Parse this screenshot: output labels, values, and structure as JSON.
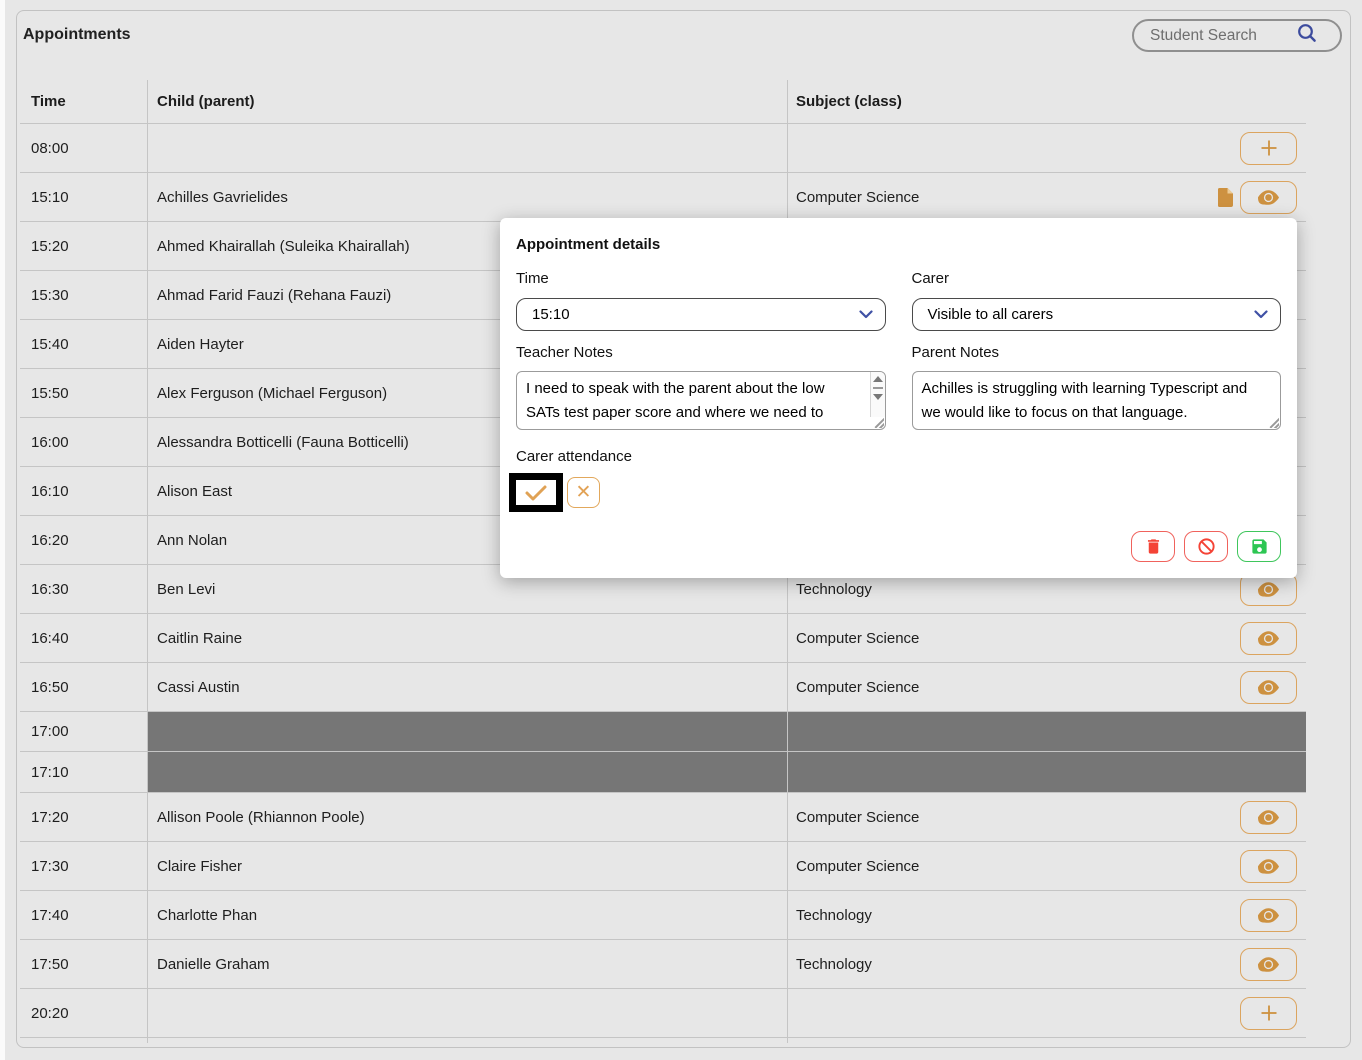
{
  "title": "Appointments",
  "search": {
    "placeholder": "Student Search"
  },
  "table": {
    "columns": {
      "time": "Time",
      "child": "Child (parent)",
      "subject": "Subject (class)"
    },
    "rows": [
      {
        "time": "08:00",
        "child": "",
        "subject": "",
        "type": "empty",
        "action": "add",
        "copy": false
      },
      {
        "time": "15:10",
        "child": "Achilles Gavrielides",
        "subject": "Computer Science",
        "type": "booked",
        "action": "view",
        "copy": true
      },
      {
        "time": "15:20",
        "child": "Ahmed Khairallah (Suleika Khairallah)",
        "subject": "",
        "type": "booked",
        "action": null,
        "copy": false
      },
      {
        "time": "15:30",
        "child": "Ahmad Farid Fauzi (Rehana Fauzi)",
        "subject": "",
        "type": "booked",
        "action": null,
        "copy": false
      },
      {
        "time": "15:40",
        "child": "Aiden Hayter",
        "subject": "",
        "type": "booked",
        "action": null,
        "copy": false
      },
      {
        "time": "15:50",
        "child": "Alex Ferguson (Michael Ferguson)",
        "subject": "",
        "type": "booked",
        "action": null,
        "copy": false
      },
      {
        "time": "16:00",
        "child": "Alessandra Botticelli (Fauna Botticelli)",
        "subject": "",
        "type": "booked",
        "action": null,
        "copy": false
      },
      {
        "time": "16:10",
        "child": "Alison East",
        "subject": "",
        "type": "booked",
        "action": null,
        "copy": false
      },
      {
        "time": "16:20",
        "child": "Ann Nolan",
        "subject": "",
        "type": "booked",
        "action": null,
        "copy": false
      },
      {
        "time": "16:30",
        "child": "Ben Levi",
        "subject": "Technology",
        "type": "booked",
        "action": "view",
        "copy": false
      },
      {
        "time": "16:40",
        "child": "Caitlin Raine",
        "subject": "Computer Science",
        "type": "booked",
        "action": "view",
        "copy": false
      },
      {
        "time": "16:50",
        "child": "Cassi Austin",
        "subject": "Computer Science",
        "type": "booked",
        "action": "view",
        "copy": false
      },
      {
        "time": "17:00",
        "child": "",
        "subject": "",
        "type": "blocked",
        "action": null,
        "copy": false
      },
      {
        "time": "17:10",
        "child": "",
        "subject": "",
        "type": "blocked",
        "action": null,
        "copy": false
      },
      {
        "time": "17:20",
        "child": "Allison Poole (Rhiannon Poole)",
        "subject": "Computer Science",
        "type": "booked",
        "action": "view",
        "copy": false
      },
      {
        "time": "17:30",
        "child": "Claire Fisher",
        "subject": "Computer Science",
        "type": "booked",
        "action": "view",
        "copy": false
      },
      {
        "time": "17:40",
        "child": "Charlotte Phan",
        "subject": "Technology",
        "type": "booked",
        "action": "view",
        "copy": false
      },
      {
        "time": "17:50",
        "child": "Danielle Graham",
        "subject": "Technology",
        "type": "booked",
        "action": "view",
        "copy": false
      },
      {
        "time": "20:20",
        "child": "",
        "subject": "",
        "type": "empty",
        "action": "add",
        "copy": false
      }
    ]
  },
  "modal": {
    "title": "Appointment details",
    "time_label": "Time",
    "time_value": "15:10",
    "carer_label": "Carer",
    "carer_value": "Visible to all carers",
    "teacher_notes_label": "Teacher Notes",
    "teacher_notes_value": "I need to speak with the parent about the low\nSATs test paper score and where we need to",
    "parent_notes_label": "Parent Notes",
    "parent_notes_value": "Achilles is struggling with learning Typescript and\nwe would like to focus on that language.",
    "attendance_label": "Carer attendance"
  },
  "colors": {
    "accent_orange": "#d2943c",
    "accent_indigo": "#3c4b9d",
    "danger_red": "#f44336",
    "success_green": "#2dc653",
    "blocked_gray": "#767676"
  }
}
